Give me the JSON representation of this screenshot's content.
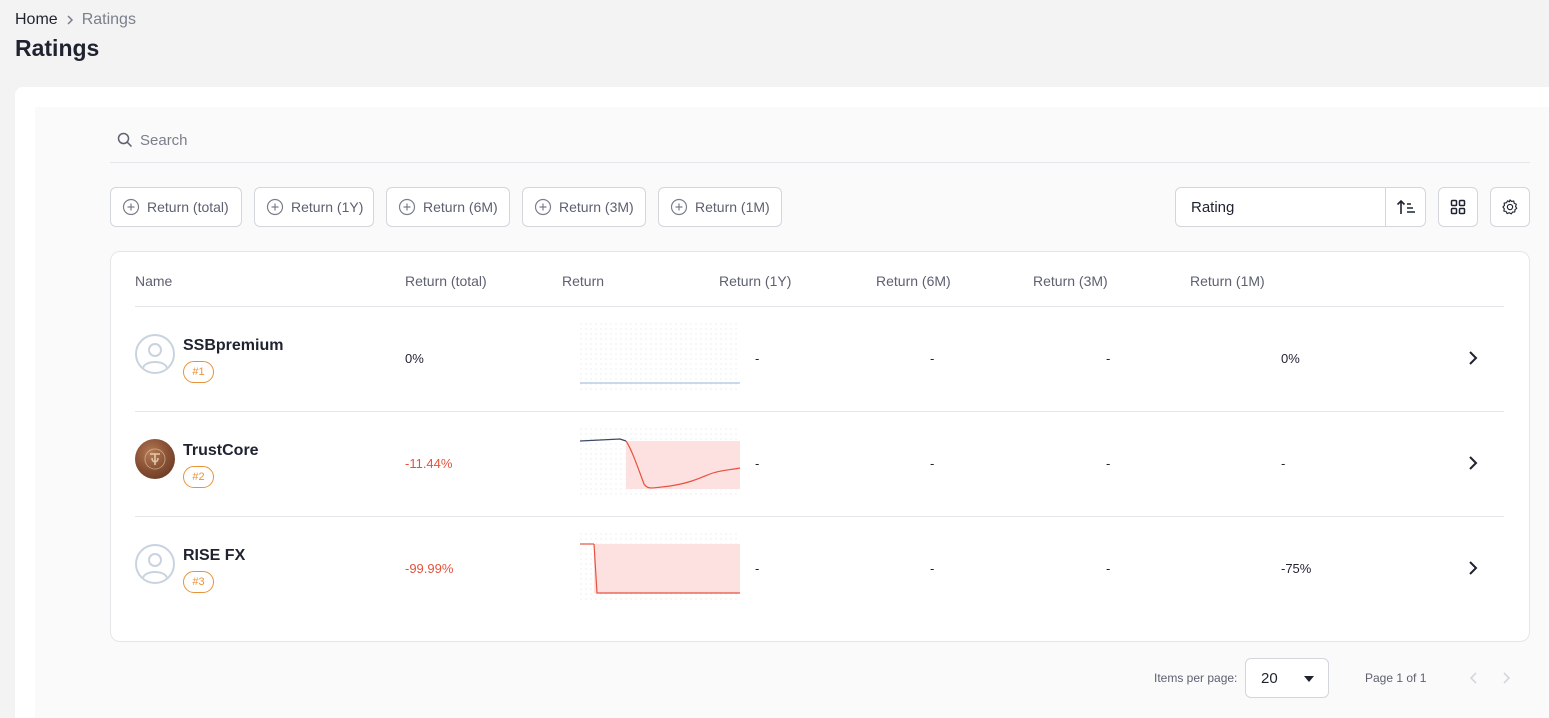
{
  "breadcrumb": {
    "home": "Home",
    "current": "Ratings"
  },
  "page_title": "Ratings",
  "search": {
    "placeholder": "Search",
    "value": ""
  },
  "filters": [
    "Return (total)",
    "Return (1Y)",
    "Return (6M)",
    "Return (3M)",
    "Return (1M)"
  ],
  "sort": {
    "value": "Rating"
  },
  "columns": [
    "Name",
    "Return (total)",
    "Return",
    "Return (1Y)",
    "Return (6M)",
    "Return (3M)",
    "Return (1M)"
  ],
  "rows": [
    {
      "name": "SSBpremium",
      "rank": "#1",
      "return_total": "0%",
      "return_1y": "-",
      "return_6m": "-",
      "return_3m": "-",
      "return_1m": "0%"
    },
    {
      "name": "TrustCore",
      "rank": "#2",
      "return_total": "-11.44%",
      "return_1y": "-",
      "return_6m": "-",
      "return_3m": "-",
      "return_1m": "-"
    },
    {
      "name": "RISE FX",
      "rank": "#3",
      "return_total": "-99.99%",
      "return_1y": "-",
      "return_6m": "-",
      "return_3m": "-",
      "return_1m": "-75%"
    }
  ],
  "pagination": {
    "items_per_page_label": "Items per page:",
    "items_per_page": "20",
    "page_info": "Page 1 of 1"
  },
  "colors": {
    "negative": "#e5533d",
    "rank_badge": "#e8933a",
    "loss_fill": "#fde0e0",
    "baseline": "#b9cde6"
  },
  "icons": [
    "chevron-right-icon",
    "search-icon",
    "plus-circle-icon",
    "sort-ascending-icon",
    "grid-icon",
    "settings-icon",
    "user-placeholder-icon",
    "chevron-left-icon"
  ]
}
